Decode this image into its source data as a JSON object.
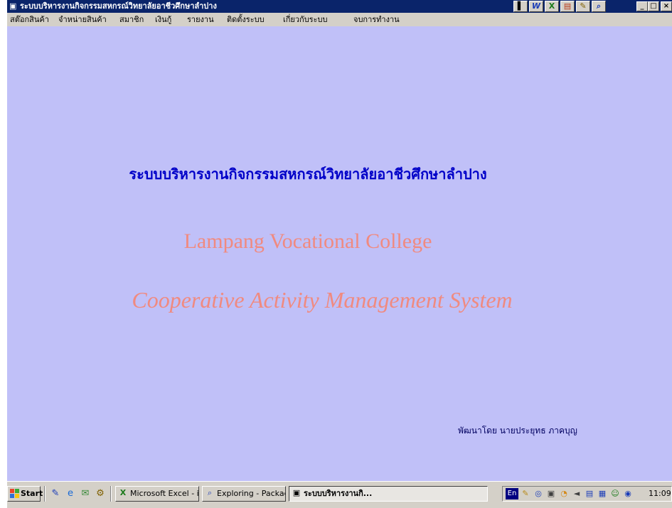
{
  "window": {
    "title": "ระบบบริหารงานกิจกรรมสหกรณ์วิทยาลัยอาชีวศึกษาลำปาง",
    "controls": {
      "minimize": "_",
      "maximize": "□",
      "close": "×"
    },
    "toolbar_icons": [
      "word-icon",
      "excel-icon",
      "powerpoint-icon",
      "tools-icon",
      "search-icon"
    ]
  },
  "menu": {
    "items": [
      "สต๊อกสินค้า",
      "จำหน่ายสินค้า",
      "สมาชิก",
      "เงินกู้",
      "รายงาน",
      "ติดตั้งระบบ",
      "เกี่ยวกับระบบ",
      "จบการทำงาน"
    ]
  },
  "main": {
    "thai_title": "ระบบบริหารงานกิจกรรมสหกรณ์วิทยาลัยอาชีวศึกษาลำปาง",
    "eng_title": "Lampang Vocational College",
    "eng_subtitle": "Cooperative Activity Management System",
    "credit": "พัฒนาโดย นายประยุทธ ภาคบุญ"
  },
  "taskbar": {
    "start_label": "Start",
    "tasks": [
      {
        "label": "Microsoft Excel - im...",
        "icon": "excel-icon"
      },
      {
        "label": "Exploring - Package",
        "icon": "explorer-icon"
      },
      {
        "label": "ระบบบริหารงานกิ...",
        "icon": "app-icon",
        "active": true
      }
    ],
    "language": "En",
    "clock": "11:09"
  },
  "colors": {
    "client_bg": "#c0c0f8",
    "thai_title": "#0000c8",
    "english_text": "#f08a80",
    "titlebar": "#0a246a"
  }
}
